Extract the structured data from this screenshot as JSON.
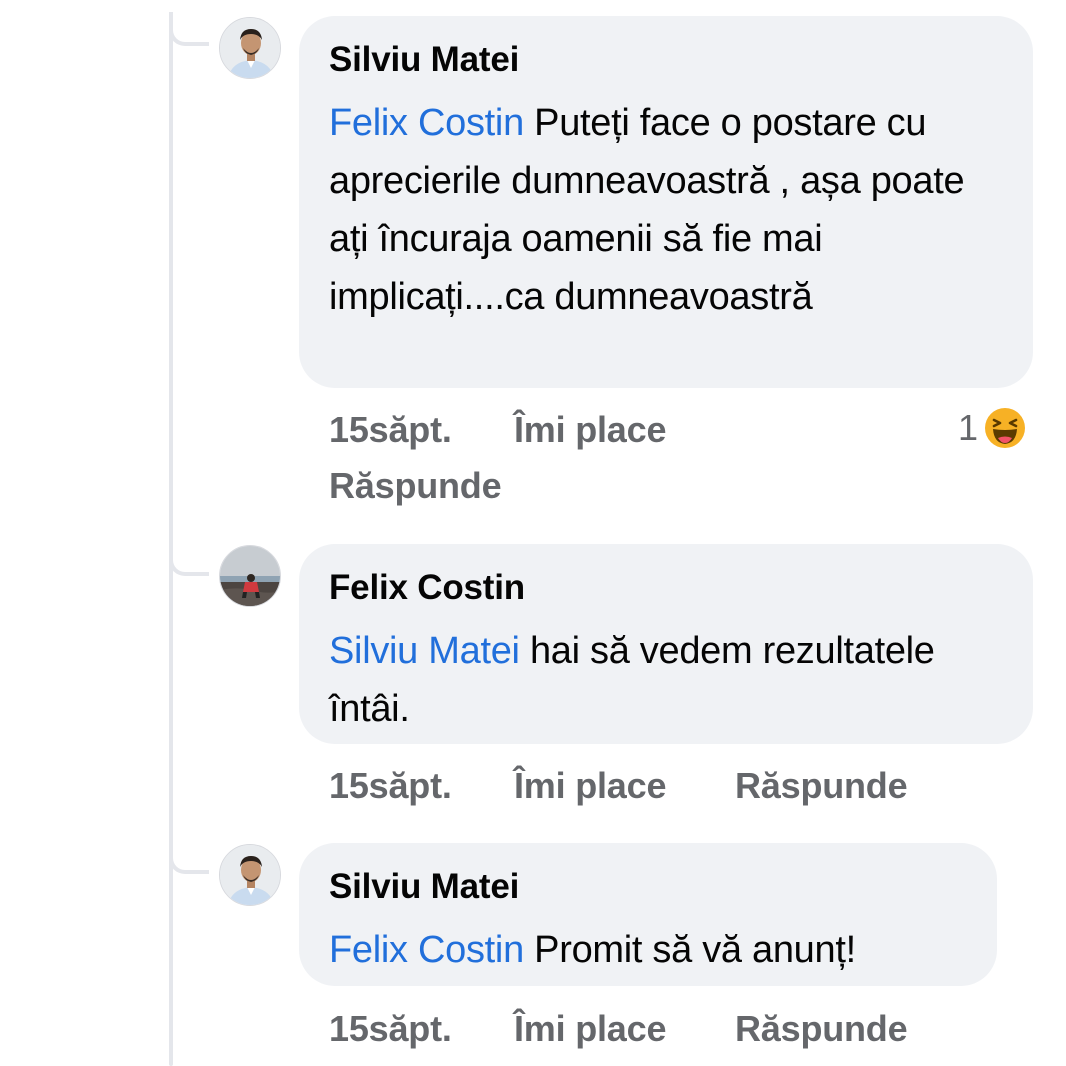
{
  "comments": [
    {
      "author": "Silviu Matei",
      "mention": "Felix Costin",
      "text": " Puteți face o postare cu aprecierile dumneavoastră , așa poate ați încuraja oamenii să fie mai implicați....ca dumneavoastră",
      "time": "15săpt.",
      "like_label": "Îmi place",
      "reply_label": "Răspunde",
      "reaction_count": "1",
      "reaction_icon": "haha-emoji-icon"
    },
    {
      "author": "Felix Costin",
      "mention": "Silviu Matei",
      "text": " hai să vedem rezultatele întâi.",
      "time": "15săpt.",
      "like_label": "Îmi place",
      "reply_label": "Răspunde"
    },
    {
      "author": "Silviu Matei",
      "mention": "Felix Costin",
      "text": " Promit să vă anunț!",
      "time": "15săpt.",
      "like_label": "Îmi place",
      "reply_label": "Răspunde"
    }
  ],
  "colors": {
    "mention": "#216fdb",
    "bubble": "#f0f2f5",
    "meta": "#65676b",
    "thread_line": "#e4e6eb",
    "reaction_yellow": "#f7b125"
  }
}
